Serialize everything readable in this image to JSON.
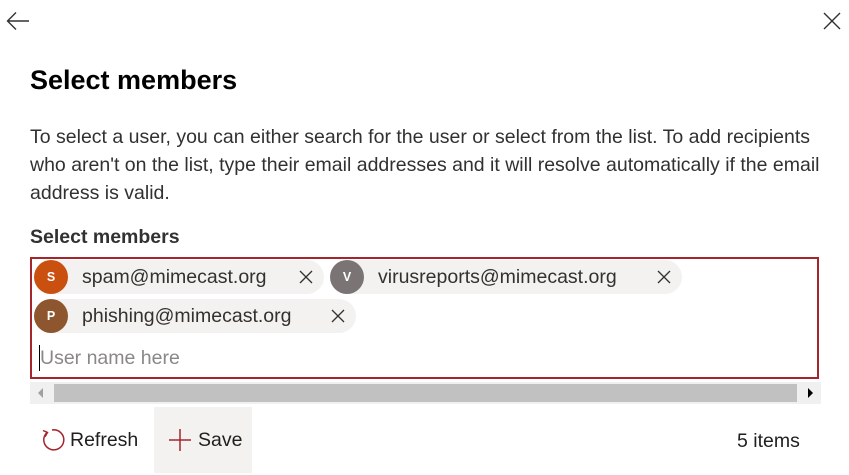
{
  "header": {
    "back_icon": "arrow-left-icon",
    "close_icon": "close-icon"
  },
  "title": "Select members",
  "description": "To select a user, you can either search for the user or select from the list. To add recipients who aren't on the list, type their email addresses and it will resolve automatically if the email address is valid.",
  "field_label": "Select members",
  "selected_members": [
    {
      "initial": "S",
      "email": "spam@mimecast.org",
      "color": "#ca5010"
    },
    {
      "initial": "V",
      "email": "virusreports@mimecast.org",
      "color": "#7a7574"
    },
    {
      "initial": "P",
      "email": "phishing@mimecast.org",
      "color": "#8e562e"
    }
  ],
  "input": {
    "value": "",
    "placeholder": "User name here"
  },
  "colors": {
    "error_border": "#a4262c",
    "accent": "#a4262c"
  },
  "toolbar": {
    "refresh_label": "Refresh",
    "save_label": "Save",
    "item_count": "5 items"
  }
}
